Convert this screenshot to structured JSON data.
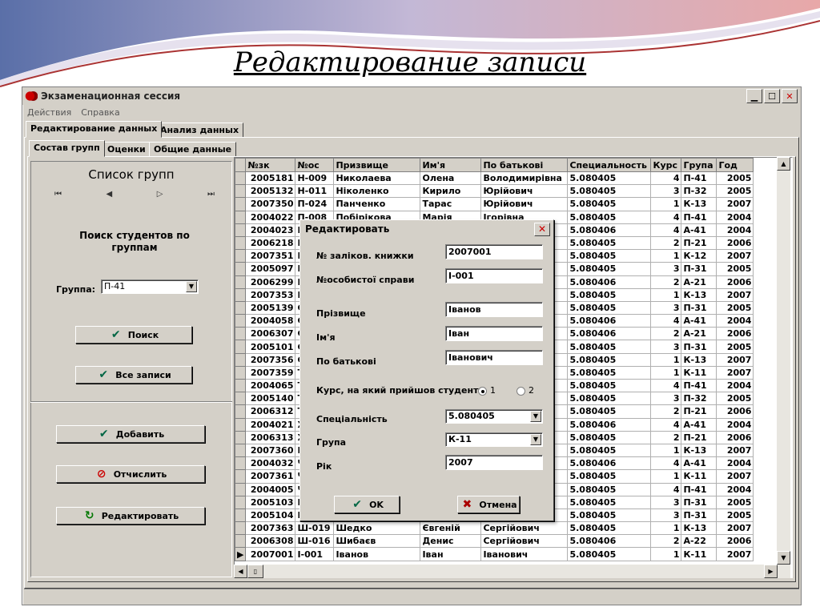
{
  "slide": {
    "title": "Редактирование записи"
  },
  "window": {
    "title": "Экзаменационная сессия",
    "menu": [
      "Действия",
      "Справка"
    ],
    "main_tabs": [
      "Редактирование данных",
      "Анализ данных"
    ],
    "sub_tabs": [
      "Состав групп",
      "Оценки",
      "Общие данные"
    ]
  },
  "left": {
    "list_title": "Список групп",
    "nav": [
      "⏮",
      "◀",
      "▷",
      "⏭"
    ],
    "search_heading": "Поиск студентов по группам",
    "group_label": "Группа:",
    "group_value": "П-41",
    "search_btn": "Поиск",
    "all_btn": "Все записи",
    "add_btn": "Добавить",
    "expel_btn": "Отчислить",
    "edit_btn": "Редактировать"
  },
  "grid": {
    "columns": [
      "№зк",
      "№ос",
      "Призвище",
      "Им'я",
      "По батькові",
      "Специальность",
      "Курс",
      "Група",
      "Год"
    ],
    "rows": [
      [
        "2005181",
        "Н-009",
        "Николаева",
        "Олена",
        "Володимирівна",
        "5.080405",
        "4",
        "П-41",
        "2005"
      ],
      [
        "2005132",
        "Н-011",
        "Ніколенко",
        "Кирило",
        "Юрійович",
        "5.080405",
        "3",
        "П-32",
        "2005"
      ],
      [
        "2007350",
        "П-024",
        "Панченко",
        "Тарас",
        "Юрійович",
        "5.080405",
        "1",
        "К-13",
        "2007"
      ],
      [
        "2004022",
        "П-008",
        "Побірікова",
        "Марія",
        "Ігорівна",
        "5.080405",
        "4",
        "П-41",
        "2004"
      ],
      [
        "2004023",
        "П",
        "",
        "",
        "",
        "5.080406",
        "4",
        "А-41",
        "2004"
      ],
      [
        "2006218",
        "П",
        "",
        "",
        "",
        "5.080405",
        "2",
        "П-21",
        "2006"
      ],
      [
        "2007351",
        "П",
        "",
        "",
        "",
        "5.080405",
        "1",
        "К-12",
        "2007"
      ],
      [
        "2005097",
        "П",
        "",
        "",
        "",
        "5.080405",
        "3",
        "П-31",
        "2005"
      ],
      [
        "2006299",
        "Р",
        "",
        "",
        "",
        "5.080406",
        "2",
        "А-21",
        "2006"
      ],
      [
        "2007353",
        "Р",
        "",
        "",
        "",
        "5.080405",
        "1",
        "К-13",
        "2007"
      ],
      [
        "2005139",
        "С",
        "",
        "",
        "",
        "5.080405",
        "3",
        "П-31",
        "2005"
      ],
      [
        "2004058",
        "С",
        "",
        "",
        "",
        "5.080406",
        "4",
        "А-41",
        "2004"
      ],
      [
        "2006307",
        "С",
        "",
        "",
        "",
        "5.080406",
        "2",
        "А-21",
        "2006"
      ],
      [
        "2005101",
        "С",
        "",
        "",
        "",
        "5.080405",
        "3",
        "П-31",
        "2005"
      ],
      [
        "2007356",
        "С",
        "",
        "",
        "",
        "5.080405",
        "1",
        "К-13",
        "2007"
      ],
      [
        "2007359",
        "Т",
        "",
        "",
        "",
        "5.080405",
        "1",
        "К-11",
        "2007"
      ],
      [
        "2004065",
        "Т",
        "",
        "",
        "",
        "5.080405",
        "4",
        "П-41",
        "2004"
      ],
      [
        "2005140",
        "Т",
        "",
        "",
        "",
        "5.080405",
        "3",
        "П-32",
        "2005"
      ],
      [
        "2006312",
        "Т",
        "",
        "",
        "",
        "5.080405",
        "2",
        "П-21",
        "2006"
      ],
      [
        "2004021",
        "Х",
        "",
        "",
        "",
        "5.080406",
        "4",
        "А-41",
        "2004"
      ],
      [
        "2006313",
        "Х",
        "",
        "",
        "",
        "5.080405",
        "2",
        "П-21",
        "2006"
      ],
      [
        "2007360",
        "Ц",
        "",
        "",
        "",
        "5.080405",
        "1",
        "К-13",
        "2007"
      ],
      [
        "2004032",
        "Ч",
        "",
        "",
        "",
        "5.080406",
        "4",
        "А-41",
        "2004"
      ],
      [
        "2007361",
        "Ч",
        "",
        "",
        "",
        "5.080405",
        "1",
        "К-11",
        "2007"
      ],
      [
        "2004005",
        "Ч",
        "",
        "",
        "",
        "5.080405",
        "4",
        "П-41",
        "2004"
      ],
      [
        "2005103",
        "Ш",
        "",
        "",
        "",
        "5.080405",
        "3",
        "П-31",
        "2005"
      ],
      [
        "2005104",
        "Ш",
        "",
        "",
        "",
        "5.080405",
        "3",
        "П-31",
        "2005"
      ],
      [
        "2007363",
        "Ш-019",
        "Шедко",
        "Євгеній",
        "Сергійович",
        "5.080405",
        "1",
        "К-13",
        "2007"
      ],
      [
        "2006308",
        "Ш-016",
        "Шибаєв",
        "Денис",
        "Сергійович",
        "5.080406",
        "2",
        "А-22",
        "2006"
      ],
      [
        "2007001",
        "І-001",
        "Іванов",
        "Іван",
        "Іванович",
        "5.080405",
        "1",
        "К-11",
        "2007"
      ]
    ],
    "current_row_marker": "▶"
  },
  "dialog": {
    "title": "Редактировать",
    "close": "✕",
    "zk_label": "№ заліков. книжки",
    "zk_value": "2007001",
    "os_label": "№особистої справи",
    "os_value": "І-001",
    "surname_label": "Прізвище",
    "surname_value": "Іванов",
    "name_label": "Ім'я",
    "name_value": "Іван",
    "patronymic_label": "По батькові",
    "patronymic_value": "Іванович",
    "course_label": "Курс, на який прийшов студент",
    "course_options": [
      "1",
      "2"
    ],
    "spec_label": "Спеціальність",
    "spec_value": "5.080405",
    "group_label": "Група",
    "group_value": "К-11",
    "year_label": "Рік",
    "year_value": "2007",
    "ok_btn": "OK",
    "cancel_btn": "Отмена"
  }
}
